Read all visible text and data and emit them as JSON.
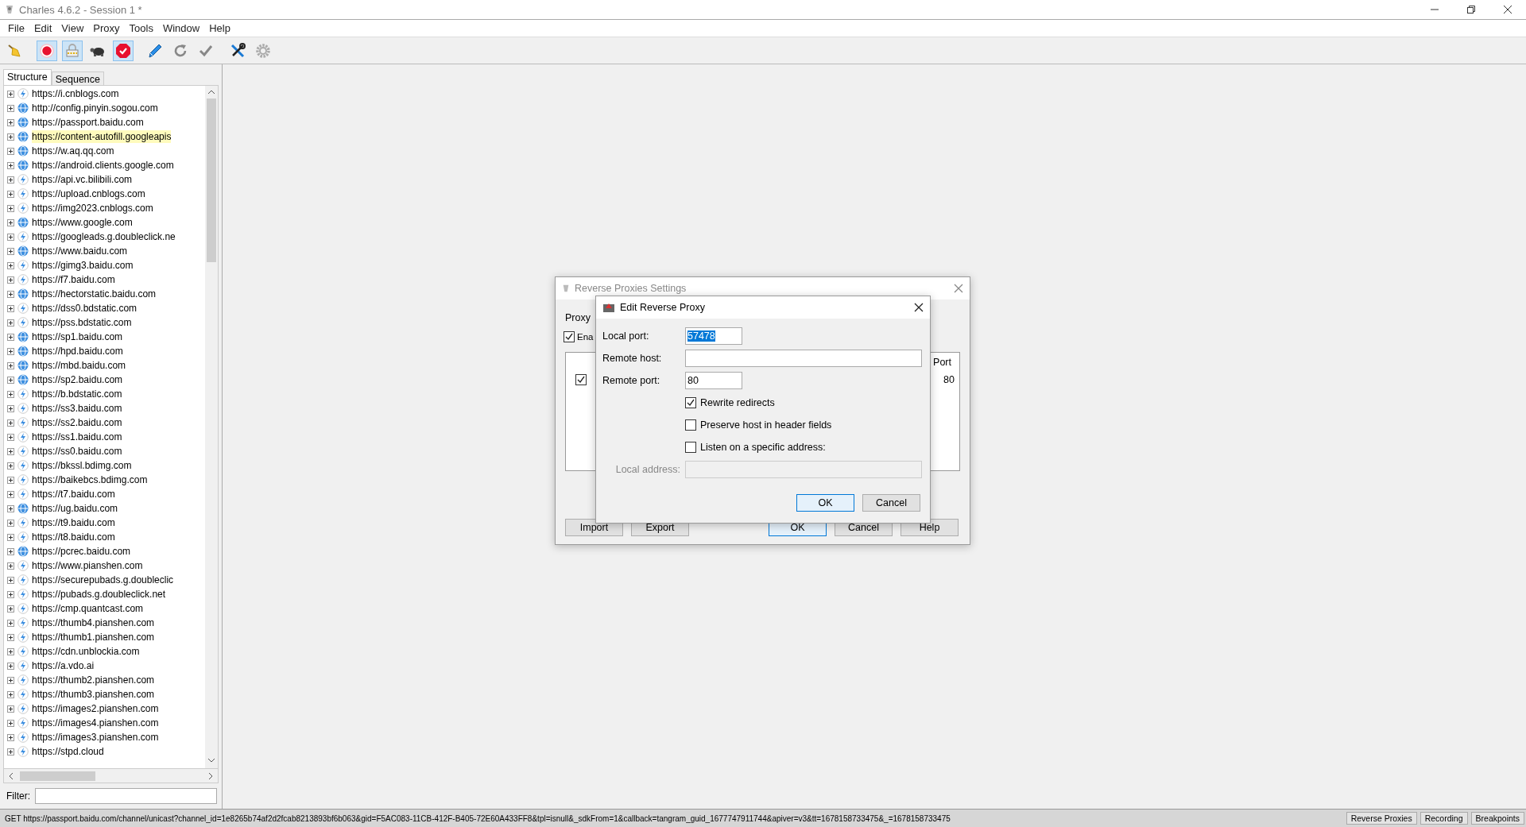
{
  "window": {
    "title": "Charles 4.6.2 - Session 1 *"
  },
  "menu": [
    "File",
    "Edit",
    "View",
    "Proxy",
    "Tools",
    "Window",
    "Help"
  ],
  "toolbar": [
    {
      "items": [
        {
          "kind": "broom",
          "selected": false
        }
      ]
    },
    {
      "items": [
        {
          "kind": "record",
          "selected": true
        },
        {
          "kind": "lock",
          "selected": true
        },
        {
          "kind": "turtle",
          "selected": false
        },
        {
          "kind": "stop",
          "selected": true
        }
      ]
    },
    {
      "items": [
        {
          "kind": "pen",
          "selected": false
        },
        {
          "kind": "refresh",
          "selected": false
        },
        {
          "kind": "check",
          "selected": false
        }
      ]
    },
    {
      "items": [
        {
          "kind": "tools",
          "selected": false
        },
        {
          "kind": "gear",
          "selected": false
        }
      ]
    }
  ],
  "tabs": [
    {
      "label": "Structure",
      "selected": true
    },
    {
      "label": "Sequence",
      "selected": false
    }
  ],
  "sidebar": {
    "items": [
      {
        "url": "https://i.cnblogs.com",
        "kind": "bolt",
        "highlighted": false
      },
      {
        "url": "http://config.pinyin.sogou.com",
        "kind": "globe",
        "highlighted": false
      },
      {
        "url": "https://passport.baidu.com",
        "kind": "globe",
        "highlighted": false
      },
      {
        "url": "https://content-autofill.googleapis",
        "kind": "globe",
        "highlighted": true
      },
      {
        "url": "https://w.aq.qq.com",
        "kind": "globe",
        "highlighted": false
      },
      {
        "url": "https://android.clients.google.com",
        "kind": "globe",
        "highlighted": false
      },
      {
        "url": "https://api.vc.bilibili.com",
        "kind": "bolt",
        "highlighted": false
      },
      {
        "url": "https://upload.cnblogs.com",
        "kind": "bolt",
        "highlighted": false
      },
      {
        "url": "https://img2023.cnblogs.com",
        "kind": "bolt",
        "highlighted": false
      },
      {
        "url": "https://www.google.com",
        "kind": "globe",
        "highlighted": false
      },
      {
        "url": "https://googleads.g.doubleclick.ne",
        "kind": "bolt",
        "highlighted": false
      },
      {
        "url": "https://www.baidu.com",
        "kind": "globe",
        "highlighted": false
      },
      {
        "url": "https://gimg3.baidu.com",
        "kind": "bolt",
        "highlighted": false
      },
      {
        "url": "https://f7.baidu.com",
        "kind": "bolt",
        "highlighted": false
      },
      {
        "url": "https://hectorstatic.baidu.com",
        "kind": "globe",
        "highlighted": false
      },
      {
        "url": "https://dss0.bdstatic.com",
        "kind": "bolt",
        "highlighted": false
      },
      {
        "url": "https://pss.bdstatic.com",
        "kind": "bolt",
        "highlighted": false
      },
      {
        "url": "https://sp1.baidu.com",
        "kind": "globe",
        "highlighted": false
      },
      {
        "url": "https://hpd.baidu.com",
        "kind": "globe",
        "highlighted": false
      },
      {
        "url": "https://mbd.baidu.com",
        "kind": "globe",
        "highlighted": false
      },
      {
        "url": "https://sp2.baidu.com",
        "kind": "globe",
        "highlighted": false
      },
      {
        "url": "https://b.bdstatic.com",
        "kind": "bolt",
        "highlighted": false
      },
      {
        "url": "https://ss3.baidu.com",
        "kind": "bolt",
        "highlighted": false
      },
      {
        "url": "https://ss2.baidu.com",
        "kind": "bolt",
        "highlighted": false
      },
      {
        "url": "https://ss1.baidu.com",
        "kind": "bolt",
        "highlighted": false
      },
      {
        "url": "https://ss0.baidu.com",
        "kind": "bolt",
        "highlighted": false
      },
      {
        "url": "https://bkssl.bdimg.com",
        "kind": "bolt",
        "highlighted": false
      },
      {
        "url": "https://baikebcs.bdimg.com",
        "kind": "bolt",
        "highlighted": false
      },
      {
        "url": "https://t7.baidu.com",
        "kind": "bolt",
        "highlighted": false
      },
      {
        "url": "https://ug.baidu.com",
        "kind": "globe",
        "highlighted": false
      },
      {
        "url": "https://t9.baidu.com",
        "kind": "bolt",
        "highlighted": false
      },
      {
        "url": "https://t8.baidu.com",
        "kind": "bolt",
        "highlighted": false
      },
      {
        "url": "https://pcrec.baidu.com",
        "kind": "globe",
        "highlighted": false
      },
      {
        "url": "https://www.pianshen.com",
        "kind": "bolt",
        "highlighted": false
      },
      {
        "url": "https://securepubads.g.doubleclic",
        "kind": "bolt",
        "highlighted": false
      },
      {
        "url": "https://pubads.g.doubleclick.net",
        "kind": "bolt",
        "highlighted": false
      },
      {
        "url": "https://cmp.quantcast.com",
        "kind": "bolt",
        "highlighted": false
      },
      {
        "url": "https://thumb4.pianshen.com",
        "kind": "bolt",
        "highlighted": false
      },
      {
        "url": "https://thumb1.pianshen.com",
        "kind": "bolt",
        "highlighted": false
      },
      {
        "url": "https://cdn.unblockia.com",
        "kind": "bolt",
        "highlighted": false
      },
      {
        "url": "https://a.vdo.ai",
        "kind": "bolt",
        "highlighted": false
      },
      {
        "url": "https://thumb2.pianshen.com",
        "kind": "bolt",
        "highlighted": false
      },
      {
        "url": "https://thumb3.pianshen.com",
        "kind": "bolt",
        "highlighted": false
      },
      {
        "url": "https://images2.pianshen.com",
        "kind": "bolt",
        "highlighted": false
      },
      {
        "url": "https://images4.pianshen.com",
        "kind": "bolt",
        "highlighted": false
      },
      {
        "url": "https://images3.pianshen.com",
        "kind": "bolt",
        "highlighted": false
      },
      {
        "url": "https://stpd.cloud",
        "kind": "bolt",
        "highlighted": false
      }
    ],
    "filter_label": "Filter:"
  },
  "settings_dialog": {
    "title": "Reverse Proxies Settings",
    "section_label": "Proxy",
    "enable": {
      "label": "Ena",
      "checked": true
    },
    "table": {
      "header": "Port",
      "rows": [
        {
          "checked": true,
          "port": "80"
        }
      ]
    },
    "buttons": [
      {
        "label": "Import",
        "default": false
      },
      {
        "label": "Export",
        "default": false
      },
      {
        "label": "OK",
        "default": true
      },
      {
        "label": "Cancel",
        "default": false
      },
      {
        "label": "Help",
        "default": false
      }
    ]
  },
  "edit_dialog": {
    "title": "Edit Reverse Proxy",
    "rows": [
      {
        "kind": "port",
        "label": "Local port:",
        "value": "57478",
        "text_selected": true,
        "disabled": false
      },
      {
        "kind": "text",
        "label": "Remote host:",
        "disabled": false
      },
      {
        "kind": "port",
        "label": "Remote port:",
        "value": "80",
        "text_selected": false,
        "disabled": false
      },
      {
        "kind": "checkbox",
        "label": "Rewrite redirects",
        "checked": true
      },
      {
        "kind": "checkbox",
        "label": "Preserve host in header fields",
        "checked": false
      },
      {
        "kind": "checkbox",
        "label": "Listen on a specific address:",
        "checked": false
      },
      {
        "kind": "text",
        "label": "Local address:",
        "disabled": true
      }
    ],
    "buttons": [
      {
        "label": "OK",
        "default": true
      },
      {
        "label": "Cancel",
        "default": false
      }
    ]
  },
  "status_bar": {
    "text": "GET https://passport.baidu.com/channel/unicast?channel_id=1e8265b74af2d2fcab8213893bf6b063&gid=F5AC083-11CB-412F-B405-72E60A433FF8&tpl=isnull&_sdkFrom=1&callback=tangram_guid_1677747911744&apiver=v3&tt=1678158733475&_=1678158733475",
    "buttons": [
      "Reverse Proxies",
      "Recording",
      "Breakpoints"
    ]
  }
}
